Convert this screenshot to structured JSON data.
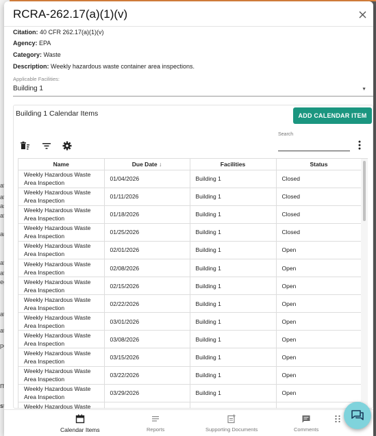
{
  "background_fragments": [
    "afe",
    "afet",
    "aste",
    "afet",
    "ans",
    "afet",
    "afet",
    "ego",
    "ate",
    "ate",
    "po",
    "me",
    "stu"
  ],
  "modal": {
    "title": "RCRA-262.17(a)(1)(v)",
    "citation_label": "Citation:",
    "citation_value": "40 CFR 262.17(a)(1)(v)",
    "agency_label": "Agency:",
    "agency_value": "EPA",
    "category_label": "Category:",
    "category_value": "Waste",
    "description_label": "Description:",
    "description_value": "Weekly hazardous waste container area inspections.",
    "facilities_label": "Applicable Facilities:",
    "facilities_value": "Building 1"
  },
  "calendar": {
    "title": "Building 1 Calendar Items",
    "add_button": "ADD CALENDAR ITEM",
    "search_label": "Search",
    "search_value": "",
    "columns": [
      "Name",
      "Due Date",
      "Facilities",
      "Status"
    ],
    "rows": [
      {
        "name": "Weekly Hazardous Waste Area Inspection",
        "due": "01/04/2026",
        "facility": "Building 1",
        "status": "Closed"
      },
      {
        "name": "Weekly Hazardous Waste Area Inspection",
        "due": "01/11/2026",
        "facility": "Building 1",
        "status": "Closed"
      },
      {
        "name": "Weekly Hazardous Waste Area Inspection",
        "due": "01/18/2026",
        "facility": "Building 1",
        "status": "Closed"
      },
      {
        "name": "Weekly Hazardous Waste Area Inspection",
        "due": "01/25/2026",
        "facility": "Building 1",
        "status": "Closed"
      },
      {
        "name": "Weekly Hazardous Waste Area Inspection",
        "due": "02/01/2026",
        "facility": "Building 1",
        "status": "Open"
      },
      {
        "name": "Weekly Hazardous Waste Area Inspection",
        "due": "02/08/2026",
        "facility": "Building 1",
        "status": "Open"
      },
      {
        "name": "Weekly Hazardous Waste Area Inspection",
        "due": "02/15/2026",
        "facility": "Building 1",
        "status": "Open"
      },
      {
        "name": "Weekly Hazardous Waste Area Inspection",
        "due": "02/22/2026",
        "facility": "Building 1",
        "status": "Open"
      },
      {
        "name": "Weekly Hazardous Waste Area Inspection",
        "due": "03/01/2026",
        "facility": "Building 1",
        "status": "Open"
      },
      {
        "name": "Weekly Hazardous Waste Area Inspection",
        "due": "03/08/2026",
        "facility": "Building 1",
        "status": "Open"
      },
      {
        "name": "Weekly Hazardous Waste Area Inspection",
        "due": "03/15/2026",
        "facility": "Building 1",
        "status": "Open"
      },
      {
        "name": "Weekly Hazardous Waste Area Inspection",
        "due": "03/22/2026",
        "facility": "Building 1",
        "status": "Open"
      },
      {
        "name": "Weekly Hazardous Waste Area Inspection",
        "due": "03/29/2026",
        "facility": "Building 1",
        "status": "Open"
      },
      {
        "name": "Weekly Hazardous Waste Area Inspection",
        "due": "",
        "facility": "",
        "status": ""
      }
    ]
  },
  "nav": {
    "calendar": "Calendar Items",
    "reports": "Reports",
    "documents": "Supporting Documents",
    "comments": "Comments"
  },
  "colors": {
    "accent": "#1b9680",
    "chat_fab": "#7fd3dc"
  },
  "icons": {
    "close": "close-icon",
    "delete": "delete-sweep-icon",
    "filter": "filter-icon",
    "settings": "gear-icon",
    "more": "more-vertical-icon",
    "calendar": "calendar-icon",
    "reports": "reports-icon",
    "documents": "document-add-icon",
    "comments": "comment-icon",
    "chat": "chat-icon"
  }
}
